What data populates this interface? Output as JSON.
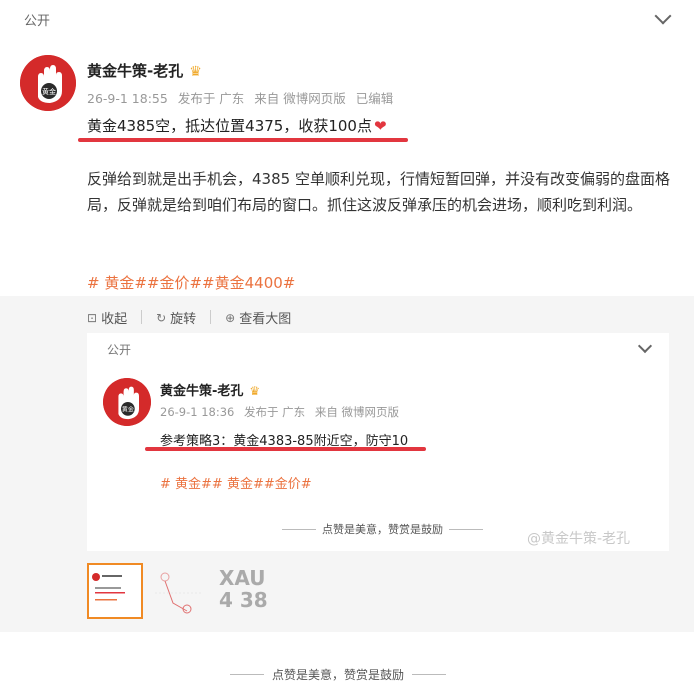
{
  "post": {
    "visibility": "公开",
    "author": "黄金牛策-老孔",
    "crown_icon": "crown-icon",
    "timestamp": "26-9-1 18:55",
    "location": "发布于 广东",
    "source": "来自 微博网页版",
    "edited": "已编辑",
    "headline": "黄金4385空，抵达位置4375，收获100点",
    "body": "反弹给到就是出手机会，4385 空单顺利兑现，行情短暂回弹，并没有改变偏弱的盘面格局，反弹就是给到咱们布局的窗口。抓住这波反弹承压的机会进场，顺利吃到利润。",
    "tags": "# 黄金##金价##黄金4400#",
    "underline_color": "#e2363f",
    "tag_color": "#eb7340"
  },
  "actions": {
    "collapse": "收起",
    "rotate": "旋转",
    "view_large": "查看大图"
  },
  "repost": {
    "visibility": "公开",
    "author": "黄金牛策-老孔",
    "timestamp": "26-9-1 18:36",
    "location": "发布于 广东",
    "source": "来自 微博网页版",
    "strategy": "参考策略3：黄金4383-85附近空，防守10",
    "tags": "# 黄金## 黄金##金价#",
    "like_line": "点赞是美意，赞赏是鼓励"
  },
  "avatar_text": "黄金",
  "watermark": "@黄金牛策-老孔",
  "thumbnails": [
    {
      "name": "thumb-repost-card",
      "active": true
    },
    {
      "name": "thumb-chart",
      "active": false
    },
    {
      "name": "thumb-xau",
      "text": "XAU 4 38",
      "active": false
    }
  ],
  "footer": {
    "like_line": "点赞是美意，赞赏是鼓励"
  }
}
